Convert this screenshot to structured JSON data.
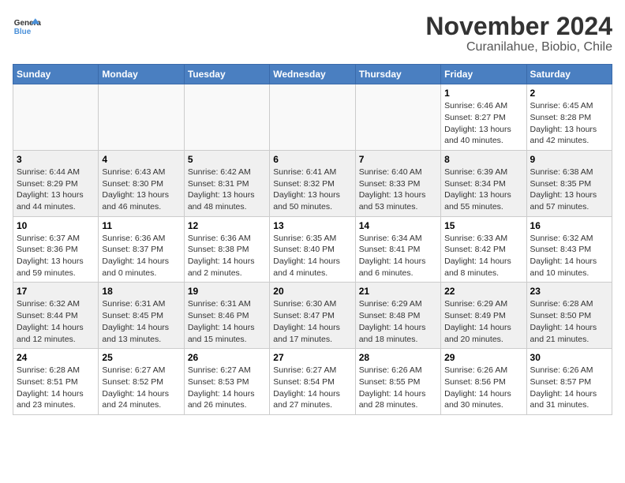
{
  "logo": {
    "line1": "General",
    "line2": "Blue"
  },
  "title": "November 2024",
  "subtitle": "Curanilahue, Biobio, Chile",
  "weekdays": [
    "Sunday",
    "Monday",
    "Tuesday",
    "Wednesday",
    "Thursday",
    "Friday",
    "Saturday"
  ],
  "weeks": [
    [
      {
        "day": "",
        "info": ""
      },
      {
        "day": "",
        "info": ""
      },
      {
        "day": "",
        "info": ""
      },
      {
        "day": "",
        "info": ""
      },
      {
        "day": "",
        "info": ""
      },
      {
        "day": "1",
        "info": "Sunrise: 6:46 AM\nSunset: 8:27 PM\nDaylight: 13 hours and 40 minutes."
      },
      {
        "day": "2",
        "info": "Sunrise: 6:45 AM\nSunset: 8:28 PM\nDaylight: 13 hours and 42 minutes."
      }
    ],
    [
      {
        "day": "3",
        "info": "Sunrise: 6:44 AM\nSunset: 8:29 PM\nDaylight: 13 hours and 44 minutes."
      },
      {
        "day": "4",
        "info": "Sunrise: 6:43 AM\nSunset: 8:30 PM\nDaylight: 13 hours and 46 minutes."
      },
      {
        "day": "5",
        "info": "Sunrise: 6:42 AM\nSunset: 8:31 PM\nDaylight: 13 hours and 48 minutes."
      },
      {
        "day": "6",
        "info": "Sunrise: 6:41 AM\nSunset: 8:32 PM\nDaylight: 13 hours and 50 minutes."
      },
      {
        "day": "7",
        "info": "Sunrise: 6:40 AM\nSunset: 8:33 PM\nDaylight: 13 hours and 53 minutes."
      },
      {
        "day": "8",
        "info": "Sunrise: 6:39 AM\nSunset: 8:34 PM\nDaylight: 13 hours and 55 minutes."
      },
      {
        "day": "9",
        "info": "Sunrise: 6:38 AM\nSunset: 8:35 PM\nDaylight: 13 hours and 57 minutes."
      }
    ],
    [
      {
        "day": "10",
        "info": "Sunrise: 6:37 AM\nSunset: 8:36 PM\nDaylight: 13 hours and 59 minutes."
      },
      {
        "day": "11",
        "info": "Sunrise: 6:36 AM\nSunset: 8:37 PM\nDaylight: 14 hours and 0 minutes."
      },
      {
        "day": "12",
        "info": "Sunrise: 6:36 AM\nSunset: 8:38 PM\nDaylight: 14 hours and 2 minutes."
      },
      {
        "day": "13",
        "info": "Sunrise: 6:35 AM\nSunset: 8:40 PM\nDaylight: 14 hours and 4 minutes."
      },
      {
        "day": "14",
        "info": "Sunrise: 6:34 AM\nSunset: 8:41 PM\nDaylight: 14 hours and 6 minutes."
      },
      {
        "day": "15",
        "info": "Sunrise: 6:33 AM\nSunset: 8:42 PM\nDaylight: 14 hours and 8 minutes."
      },
      {
        "day": "16",
        "info": "Sunrise: 6:32 AM\nSunset: 8:43 PM\nDaylight: 14 hours and 10 minutes."
      }
    ],
    [
      {
        "day": "17",
        "info": "Sunrise: 6:32 AM\nSunset: 8:44 PM\nDaylight: 14 hours and 12 minutes."
      },
      {
        "day": "18",
        "info": "Sunrise: 6:31 AM\nSunset: 8:45 PM\nDaylight: 14 hours and 13 minutes."
      },
      {
        "day": "19",
        "info": "Sunrise: 6:31 AM\nSunset: 8:46 PM\nDaylight: 14 hours and 15 minutes."
      },
      {
        "day": "20",
        "info": "Sunrise: 6:30 AM\nSunset: 8:47 PM\nDaylight: 14 hours and 17 minutes."
      },
      {
        "day": "21",
        "info": "Sunrise: 6:29 AM\nSunset: 8:48 PM\nDaylight: 14 hours and 18 minutes."
      },
      {
        "day": "22",
        "info": "Sunrise: 6:29 AM\nSunset: 8:49 PM\nDaylight: 14 hours and 20 minutes."
      },
      {
        "day": "23",
        "info": "Sunrise: 6:28 AM\nSunset: 8:50 PM\nDaylight: 14 hours and 21 minutes."
      }
    ],
    [
      {
        "day": "24",
        "info": "Sunrise: 6:28 AM\nSunset: 8:51 PM\nDaylight: 14 hours and 23 minutes."
      },
      {
        "day": "25",
        "info": "Sunrise: 6:27 AM\nSunset: 8:52 PM\nDaylight: 14 hours and 24 minutes."
      },
      {
        "day": "26",
        "info": "Sunrise: 6:27 AM\nSunset: 8:53 PM\nDaylight: 14 hours and 26 minutes."
      },
      {
        "day": "27",
        "info": "Sunrise: 6:27 AM\nSunset: 8:54 PM\nDaylight: 14 hours and 27 minutes."
      },
      {
        "day": "28",
        "info": "Sunrise: 6:26 AM\nSunset: 8:55 PM\nDaylight: 14 hours and 28 minutes."
      },
      {
        "day": "29",
        "info": "Sunrise: 6:26 AM\nSunset: 8:56 PM\nDaylight: 14 hours and 30 minutes."
      },
      {
        "day": "30",
        "info": "Sunrise: 6:26 AM\nSunset: 8:57 PM\nDaylight: 14 hours and 31 minutes."
      }
    ]
  ]
}
